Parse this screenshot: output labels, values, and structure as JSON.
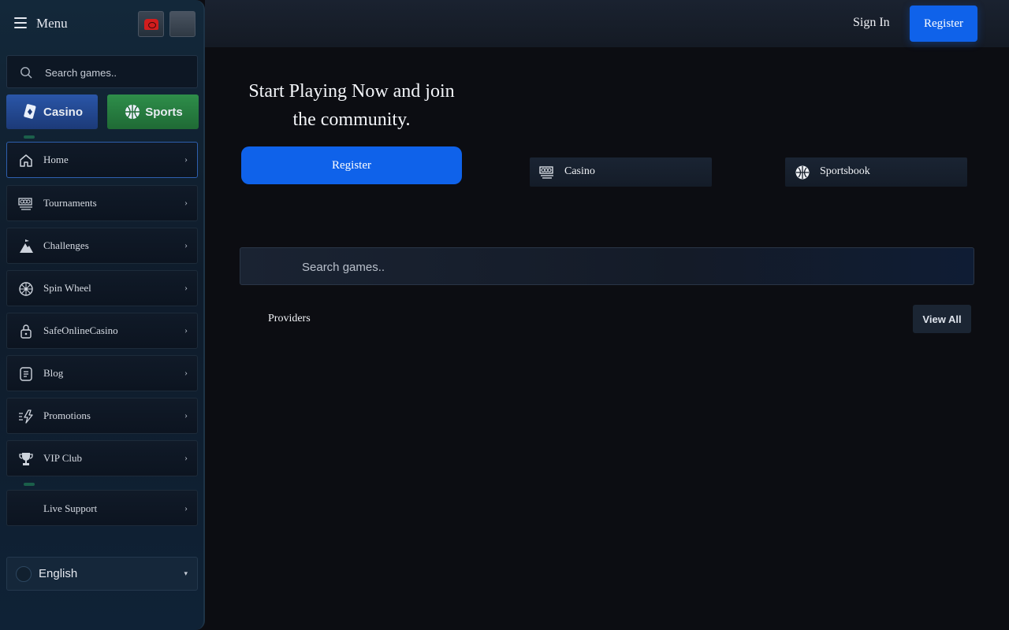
{
  "sidebar": {
    "menu_label": "Menu",
    "search_placeholder": "Search games..",
    "pills": {
      "casino": "Casino",
      "sports": "Sports"
    },
    "items": [
      {
        "label": "Home",
        "icon": "home-icon"
      },
      {
        "label": "Tournaments",
        "icon": "tournaments-icon"
      },
      {
        "label": "Challenges",
        "icon": "mountain-flag-icon"
      },
      {
        "label": "Spin Wheel",
        "icon": "wheel-icon"
      },
      {
        "label": "SafeOnlineCasino",
        "icon": "lock-icon"
      },
      {
        "label": "Blog",
        "icon": "document-icon"
      },
      {
        "label": "Promotions",
        "icon": "lightning-icon"
      },
      {
        "label": "VIP Club",
        "icon": "trophy-icon"
      },
      {
        "label": "Live Support",
        "icon": ""
      }
    ],
    "chevron": "›",
    "language": "English",
    "language_caret": "▾"
  },
  "topbar": {
    "sign_in": "Sign In",
    "register": "Register"
  },
  "main": {
    "hero_line1": "Start Playing Now and join",
    "hero_line2": "the community.",
    "register_button": "Register",
    "quick_links": {
      "casino": "Casino",
      "sportsbook": "Sportsbook"
    },
    "search_placeholder": "Search games..",
    "providers_label": "Providers",
    "view_all": "View All"
  },
  "colors": {
    "accent_blue": "#0f62ea",
    "background": "#0c0d12",
    "sidebar": "#13283a",
    "sports_green": "#2e8e4a"
  }
}
